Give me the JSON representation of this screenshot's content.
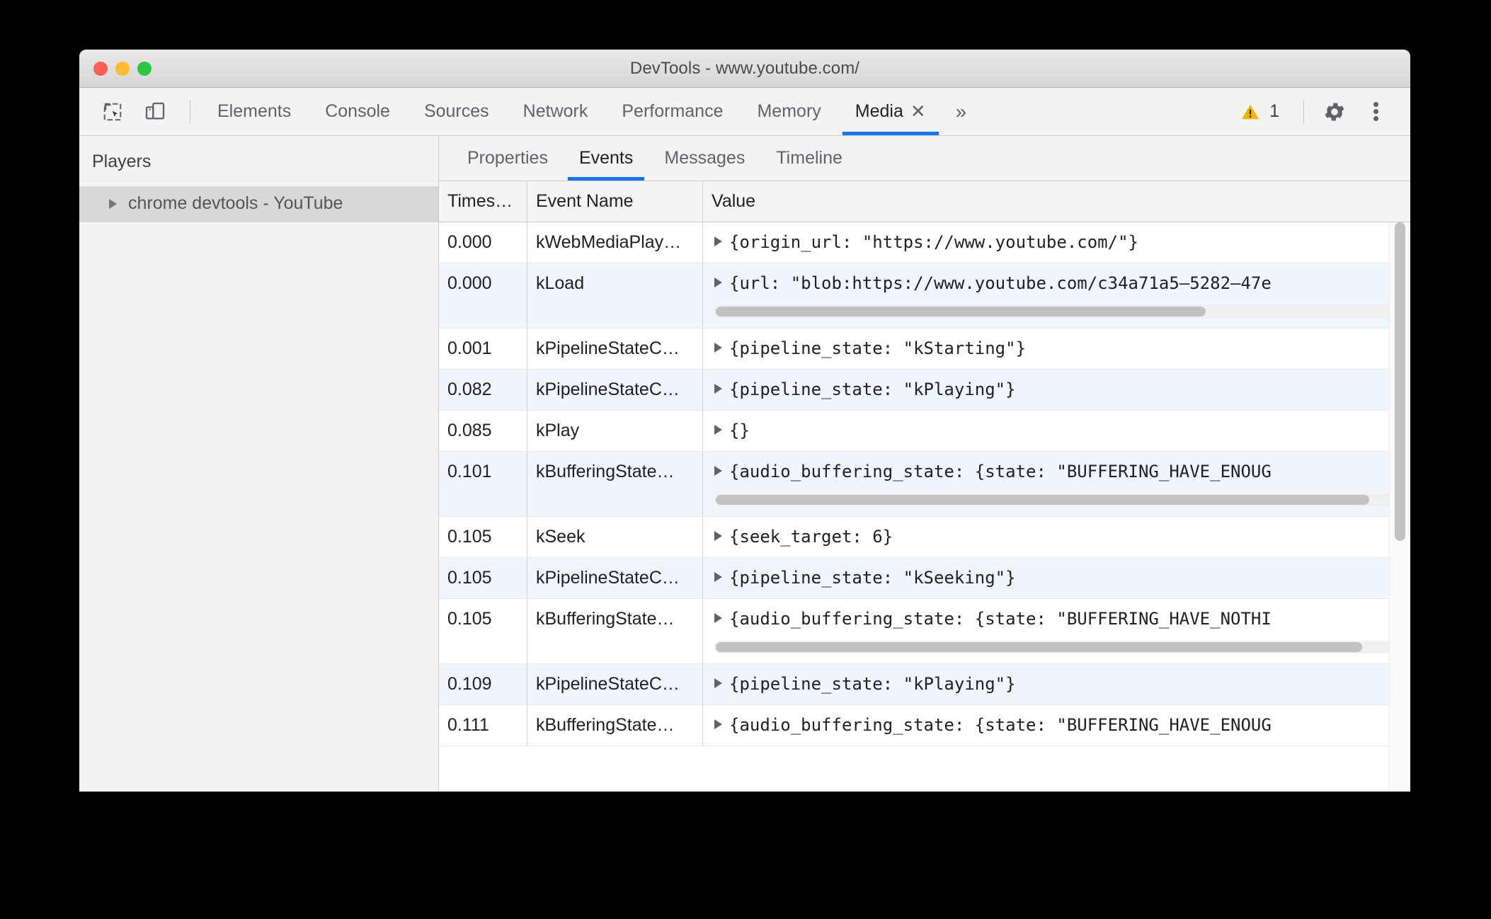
{
  "window": {
    "title": "DevTools - www.youtube.com/",
    "traffic_lights": [
      "close-red",
      "minimize-yellow",
      "maximize-green"
    ]
  },
  "toolbar": {
    "inspect_icon": "inspect-element-icon",
    "device_icon": "device-toolbar-icon",
    "tabs": [
      {
        "label": "Elements",
        "active": false
      },
      {
        "label": "Console",
        "active": false
      },
      {
        "label": "Sources",
        "active": false
      },
      {
        "label": "Network",
        "active": false
      },
      {
        "label": "Performance",
        "active": false
      },
      {
        "label": "Memory",
        "active": false
      },
      {
        "label": "Media",
        "active": true,
        "closable": true
      }
    ],
    "close_glyph": "✕",
    "overflow_glyph": "»",
    "warning_icon": "warning-triangle-icon",
    "warning_count": "1",
    "gear_icon": "settings-gear-icon",
    "kebab_icon": "more-options-icon",
    "accent_color": "#1a73e8",
    "warning_color": "#f5b400"
  },
  "sidebar": {
    "title": "Players",
    "items": [
      {
        "label": "chrome devtools - YouTube",
        "selected": true,
        "expander": "▶"
      }
    ]
  },
  "subtabs": [
    {
      "label": "Properties",
      "active": false
    },
    {
      "label": "Events",
      "active": true
    },
    {
      "label": "Messages",
      "active": false
    },
    {
      "label": "Timeline",
      "active": false
    }
  ],
  "table": {
    "columns": [
      "Times…",
      "Event Name",
      "Value"
    ],
    "rows": [
      {
        "time": "0.000",
        "event": "kWebMediaPlay…",
        "value": "{origin_url: \"https://www.youtube.com/\"}",
        "scrollbar": null
      },
      {
        "time": "0.000",
        "event": "kLoad",
        "value": "{url: \"blob:https://www.youtube.com/c34a71a5‒5282‒47e",
        "scrollbar": {
          "thumb_percent": 72
        }
      },
      {
        "time": "0.001",
        "event": "kPipelineStateC…",
        "value": "{pipeline_state: \"kStarting\"}",
        "scrollbar": null
      },
      {
        "time": "0.082",
        "event": "kPipelineStateC…",
        "value": "{pipeline_state: \"kPlaying\"}",
        "scrollbar": null
      },
      {
        "time": "0.085",
        "event": "kPlay",
        "value": "{}",
        "scrollbar": null
      },
      {
        "time": "0.101",
        "event": "kBufferingState…",
        "value": "{audio_buffering_state: {state: \"BUFFERING_HAVE_ENOUG",
        "scrollbar": {
          "thumb_percent": 96
        }
      },
      {
        "time": "0.105",
        "event": "kSeek",
        "value": "{seek_target: 6}",
        "scrollbar": null
      },
      {
        "time": "0.105",
        "event": "kPipelineStateC…",
        "value": "{pipeline_state: \"kSeeking\"}",
        "scrollbar": null
      },
      {
        "time": "0.105",
        "event": "kBufferingState…",
        "value": "{audio_buffering_state: {state: \"BUFFERING_HAVE_NOTHI",
        "scrollbar": {
          "thumb_percent": 95
        }
      },
      {
        "time": "0.109",
        "event": "kPipelineStateC…",
        "value": "{pipeline_state: \"kPlaying\"}",
        "scrollbar": null
      },
      {
        "time": "0.111",
        "event": "kBufferingState…",
        "value": "{audio_buffering_state: {state: \"BUFFERING_HAVE_ENOUG",
        "scrollbar": null
      }
    ],
    "expand_glyph": "▶",
    "vertical_scrollbar": {
      "top_percent": 0,
      "height_percent": 56
    }
  }
}
